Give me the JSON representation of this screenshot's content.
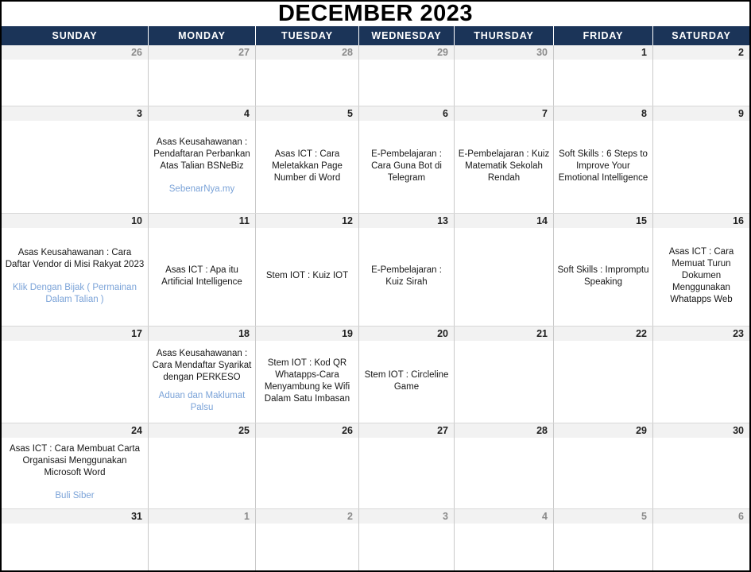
{
  "header": {
    "title": "DECEMBER 2023"
  },
  "weekdays": [
    "SUNDAY",
    "MONDAY",
    "TUESDAY",
    "WEDNESDAY",
    "THURSDAY",
    "FRIDAY",
    "SATURDAY"
  ],
  "colors": {
    "header_bg": "#1b3458",
    "header_text": "#ffffff",
    "date_strip_bg": "#f2f2f2",
    "date_text": "#1f1f1f",
    "date_text_muted": "#8a8a8a",
    "event_text": "#171717",
    "event_link": "#7ba3d8",
    "border": "#000000"
  },
  "weeks": [
    {
      "days": [
        {
          "date": "26",
          "muted": true,
          "event": "",
          "link": ""
        },
        {
          "date": "27",
          "muted": true,
          "event": "",
          "link": ""
        },
        {
          "date": "28",
          "muted": true,
          "event": "",
          "link": ""
        },
        {
          "date": "29",
          "muted": true,
          "event": "",
          "link": ""
        },
        {
          "date": "30",
          "muted": true,
          "event": "",
          "link": ""
        },
        {
          "date": "1",
          "muted": false,
          "event": "",
          "link": ""
        },
        {
          "date": "2",
          "muted": false,
          "event": "",
          "link": ""
        }
      ]
    },
    {
      "days": [
        {
          "date": "3",
          "muted": false,
          "event": "",
          "link": ""
        },
        {
          "date": "4",
          "muted": false,
          "event": "Asas Keusahawanan : Pendaftaran Perbankan Atas Talian BSNeBiz",
          "link": "SebenarNya.my"
        },
        {
          "date": "5",
          "muted": false,
          "event": "Asas ICT : Cara Meletakkan Page Number di Word",
          "link": ""
        },
        {
          "date": "6",
          "muted": false,
          "event": "E-Pembelajaran : Cara Guna Bot di Telegram",
          "link": ""
        },
        {
          "date": "7",
          "muted": false,
          "event": "E-Pembelajaran : Kuiz Matematik Sekolah Rendah",
          "link": ""
        },
        {
          "date": "8",
          "muted": false,
          "event": "Soft Skills : 6 Steps to Improve Your Emotional Intelligence",
          "link": ""
        },
        {
          "date": "9",
          "muted": false,
          "event": "",
          "link": ""
        }
      ]
    },
    {
      "days": [
        {
          "date": "10",
          "muted": false,
          "event": "Asas Keusahawanan : Cara Daftar Vendor di Misi Rakyat 2023",
          "link": "Klik Dengan Bijak ( Permainan Dalam Talian )"
        },
        {
          "date": "11",
          "muted": false,
          "event": "Asas ICT : Apa itu Artificial Intelligence",
          "link": ""
        },
        {
          "date": "12",
          "muted": false,
          "event": "Stem IOT : Kuiz IOT",
          "link": ""
        },
        {
          "date": "13",
          "muted": false,
          "event": "E-Pembelajaran : Kuiz Sirah",
          "link": ""
        },
        {
          "date": "14",
          "muted": false,
          "event": "",
          "link": ""
        },
        {
          "date": "15",
          "muted": false,
          "event": "Soft Skills : Impromptu Speaking",
          "link": ""
        },
        {
          "date": "16",
          "muted": false,
          "event": "Asas ICT : Cara Memuat Turun Dokumen Menggunakan Whatapps Web",
          "link": ""
        }
      ]
    },
    {
      "days": [
        {
          "date": "17",
          "muted": false,
          "event": "",
          "link": ""
        },
        {
          "date": "18",
          "muted": false,
          "event": "Asas Keusahawanan : Cara Mendaftar Syarikat dengan PERKESO",
          "link": "Aduan dan Maklumat Palsu"
        },
        {
          "date": "19",
          "muted": false,
          "event": "Stem IOT : Kod QR Whatapps-Cara Menyambung ke Wifi Dalam Satu Imbasan",
          "link": ""
        },
        {
          "date": "20",
          "muted": false,
          "event": "Stem IOT : Circleline Game",
          "link": ""
        },
        {
          "date": "21",
          "muted": false,
          "event": "",
          "link": ""
        },
        {
          "date": "22",
          "muted": false,
          "event": "",
          "link": ""
        },
        {
          "date": "23",
          "muted": false,
          "event": "",
          "link": ""
        }
      ]
    },
    {
      "days": [
        {
          "date": "24",
          "muted": false,
          "event": "Asas ICT : Cara Membuat Carta Organisasi Menggunakan Microsoft Word",
          "link": "Buli Siber"
        },
        {
          "date": "25",
          "muted": false,
          "event": "",
          "link": ""
        },
        {
          "date": "26",
          "muted": false,
          "event": "",
          "link": ""
        },
        {
          "date": "27",
          "muted": false,
          "event": "",
          "link": ""
        },
        {
          "date": "28",
          "muted": false,
          "event": "",
          "link": ""
        },
        {
          "date": "29",
          "muted": false,
          "event": "",
          "link": ""
        },
        {
          "date": "30",
          "muted": false,
          "event": "",
          "link": ""
        }
      ]
    },
    {
      "days": [
        {
          "date": "31",
          "muted": false,
          "event": "",
          "link": ""
        },
        {
          "date": "1",
          "muted": true,
          "event": "",
          "link": ""
        },
        {
          "date": "2",
          "muted": true,
          "event": "",
          "link": ""
        },
        {
          "date": "3",
          "muted": true,
          "event": "",
          "link": ""
        },
        {
          "date": "4",
          "muted": true,
          "event": "",
          "link": ""
        },
        {
          "date": "5",
          "muted": true,
          "event": "",
          "link": ""
        },
        {
          "date": "6",
          "muted": true,
          "event": "",
          "link": ""
        }
      ]
    }
  ]
}
